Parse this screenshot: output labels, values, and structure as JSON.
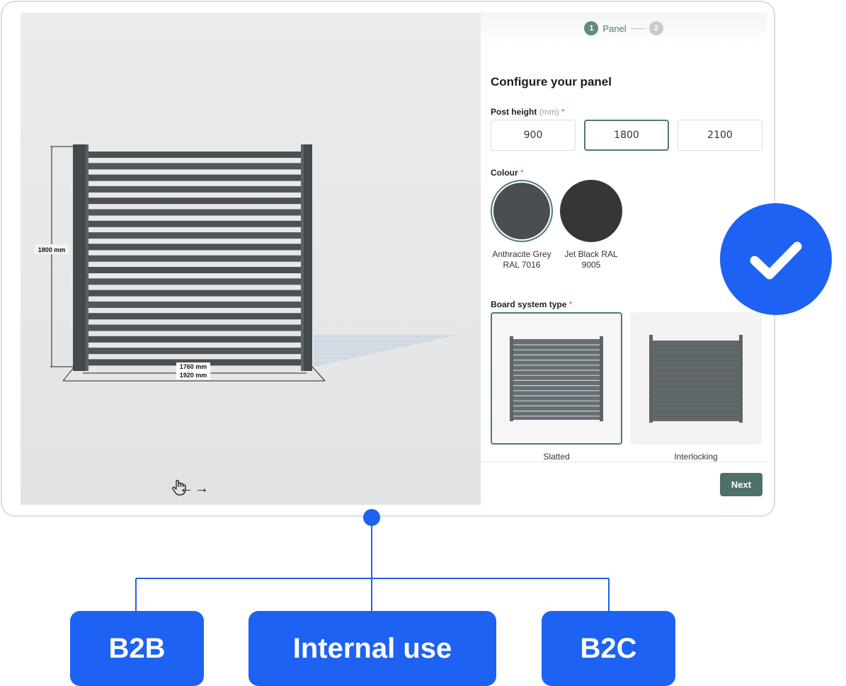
{
  "viewer": {
    "height_dimension": "1800 mm",
    "inner_width_dimension": "1760 mm",
    "outer_width_dimension": "1920 mm",
    "rotate_hint": {
      "left_arrow": "←",
      "right_arrow": "→",
      "icon": "hand-drag-icon"
    }
  },
  "stepper": {
    "steps": [
      {
        "number": "1",
        "label": "Panel",
        "active": true
      },
      {
        "number": "2",
        "label": "",
        "active": false
      }
    ]
  },
  "configurator": {
    "title": "Configure your panel",
    "post_height": {
      "label": "Post height",
      "unit": "(mm)",
      "required_mark": "*",
      "options": [
        "900",
        "1800",
        "2100"
      ],
      "selected": "1800"
    },
    "colour": {
      "label": "Colour",
      "required_mark": "*",
      "options": [
        {
          "name": "Anthracite Grey RAL 7016",
          "color": "#4a4d51",
          "selected": true
        },
        {
          "name": "Jet Black RAL 9005",
          "color": "#353637",
          "selected": false
        }
      ]
    },
    "board_system": {
      "label": "Board system type",
      "required_mark": "*",
      "options": [
        {
          "name": "Slatted",
          "selected": true
        },
        {
          "name": "Interlocking",
          "selected": false
        }
      ]
    },
    "next_label": "Next"
  },
  "segments": [
    "B2B",
    "Internal use",
    "B2C"
  ],
  "colors": {
    "accent_blue": "#1d62f2",
    "brand_green": "#4f7a73",
    "next_button": "#4f6f69",
    "fence": "#4a5054"
  }
}
